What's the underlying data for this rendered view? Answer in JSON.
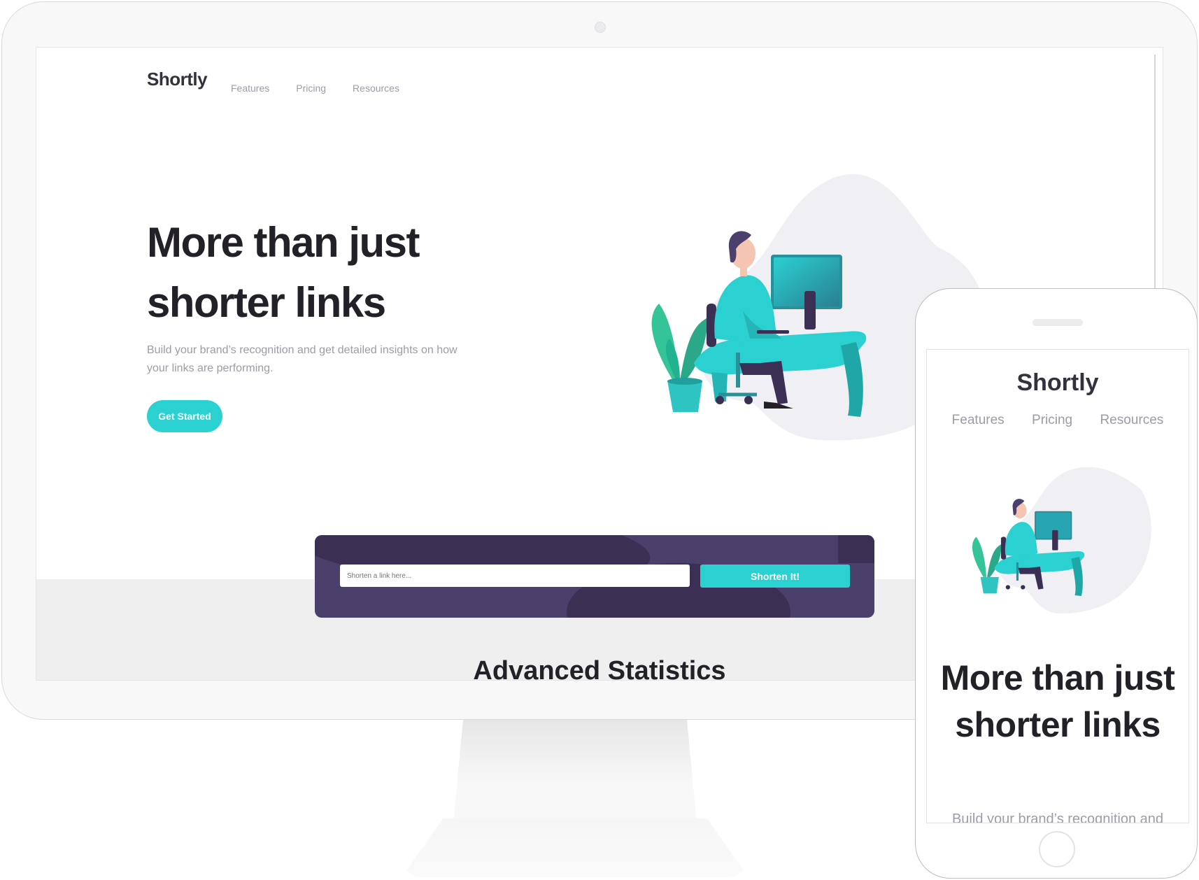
{
  "colors": {
    "brand_cyan": "#2bd0d0",
    "dark_violet": "#3b3054",
    "shorten_panel": "#4b3f6b",
    "heading": "#232127",
    "muted_text": "#9e9aa7",
    "section_bg": "#efefef"
  },
  "desktop": {
    "logo": "Shortly",
    "nav": [
      "Features",
      "Pricing",
      "Resources"
    ],
    "hero": {
      "title": "More than just shorter links",
      "description": "Build your brand’s recognition and get detailed insights on how your links are performing.",
      "cta_label": "Get Started",
      "illustration": "person-working-at-desk-illustration"
    },
    "shorten": {
      "placeholder": "Shorten a link here...",
      "button_label": "Shorten It!"
    },
    "section_title": "Advanced Statistics"
  },
  "mobile": {
    "logo": "Shortly",
    "nav": [
      "Features",
      "Pricing",
      "Resources"
    ],
    "hero": {
      "title": "More than just shorter links",
      "description": "Build your brand’s recognition and",
      "illustration": "person-working-at-desk-illustration"
    }
  }
}
